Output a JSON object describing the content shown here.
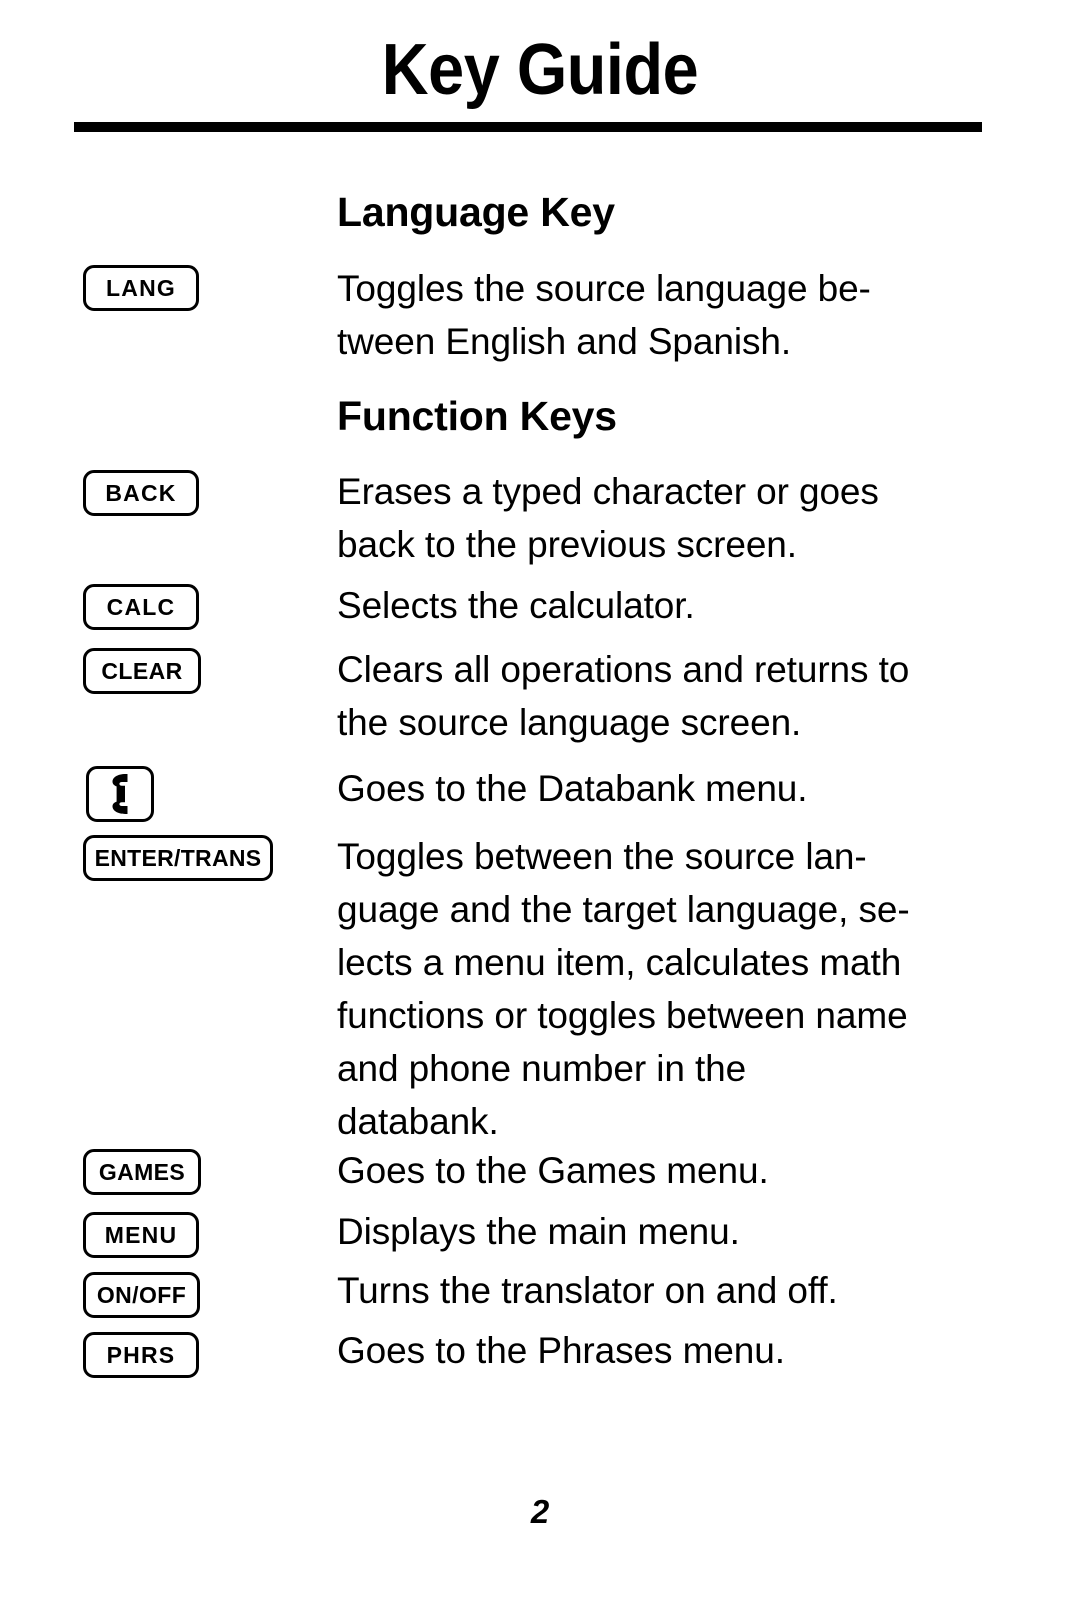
{
  "document": {
    "title": "Key Guide",
    "page_number": "2"
  },
  "sections": [
    {
      "heading": "Language Key",
      "rows": [
        {
          "key_label": "LANG",
          "key_icon": null,
          "description": "Toggles the source language be- tween English and Spanish."
        }
      ]
    },
    {
      "heading": "Function Keys",
      "rows": [
        {
          "key_label": "BACK",
          "key_icon": null,
          "description": "Erases a typed character or goes back to the previous screen."
        },
        {
          "key_label": "CALC",
          "key_icon": null,
          "description": "Selects the calculator."
        },
        {
          "key_label": "CLEAR",
          "key_icon": null,
          "description": "Clears all operations and returns to the source language screen."
        },
        {
          "key_label": "",
          "key_icon": "telephone-handset-icon",
          "description": "Goes to the Databank menu."
        },
        {
          "key_label": "ENTER/TRANS",
          "key_icon": null,
          "description": "Toggles between the source lan- guage and the target language, se- lects a menu item, calculates math functions or toggles between name and phone number in the databank."
        },
        {
          "key_label": "GAMES",
          "key_icon": null,
          "description": "Goes to the Games menu."
        },
        {
          "key_label": "MENU",
          "key_icon": null,
          "description": "Displays the main menu."
        },
        {
          "key_label": "ON/OFF",
          "key_icon": null,
          "description": "Turns the translator on and off."
        },
        {
          "key_label": "PHRS",
          "key_icon": null,
          "description": "Goes to the Phrases menu."
        }
      ]
    }
  ],
  "lines": {
    "lang": [
      "Toggles the source language be-",
      "tween English and Spanish."
    ],
    "back": [
      "Erases a typed character or goes",
      "back to the previous screen."
    ],
    "calc": [
      "Selects the calculator."
    ],
    "clear": [
      "Clears all operations and returns to",
      "the source language screen."
    ],
    "phone": [
      "Goes to the Databank menu."
    ],
    "enter": [
      "Toggles between the source lan-",
      "guage and the target language, se-",
      "lects a menu item, calculates math",
      "functions or toggles between name",
      "and phone number in the",
      "databank."
    ],
    "games": [
      "Goes to the Games menu."
    ],
    "menu": [
      "Displays the main menu."
    ],
    "onoff": [
      "Turns the translator on and off."
    ],
    "phrs": [
      "Goes to the Phrases menu."
    ]
  },
  "keys": {
    "lang": "LANG",
    "back": "BACK",
    "calc": "CALC",
    "clear": "CLEAR",
    "enter": "ENTER/TRANS",
    "games": "GAMES",
    "menu": "MENU",
    "onoff": "ON/OFF",
    "phrs": "PHRS"
  },
  "colors": {
    "ink": "#000000",
    "paper": "#ffffff"
  }
}
